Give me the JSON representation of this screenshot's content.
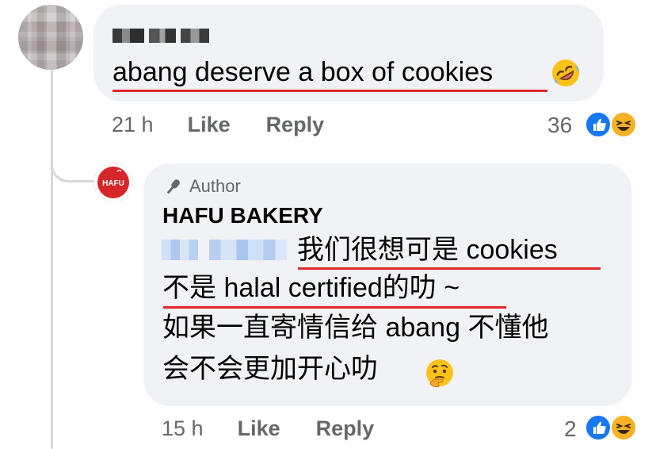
{
  "comment": {
    "text": "abang deserve a box of cookies",
    "emoji": "rolling-on-floor-laughing-emoji",
    "time": "21 h",
    "like_label": "Like",
    "reply_label": "Reply",
    "reaction_count": "36"
  },
  "reply": {
    "author_badge": "Author",
    "author_name": "HAFU BAKERY",
    "avatar_text": "HAFU",
    "line1": "我们很想可是 cookies",
    "line2": "不是 halal certified的叻 ~",
    "line3": "如果一直寄情信给 abang 不懂他",
    "line4": "会不会更加开心叻",
    "emoji": "thinking-face-emoji",
    "time": "15 h",
    "like_label": "Like",
    "reply_label": "Reply",
    "reaction_count": "2"
  },
  "colors": {
    "bubble": "#f0f2f5",
    "meta": "#65676b",
    "underline": "#e0272e",
    "like_blue": "#1877f2",
    "haha_yellow": "#f7b125",
    "brand_red": "#d7262a"
  }
}
